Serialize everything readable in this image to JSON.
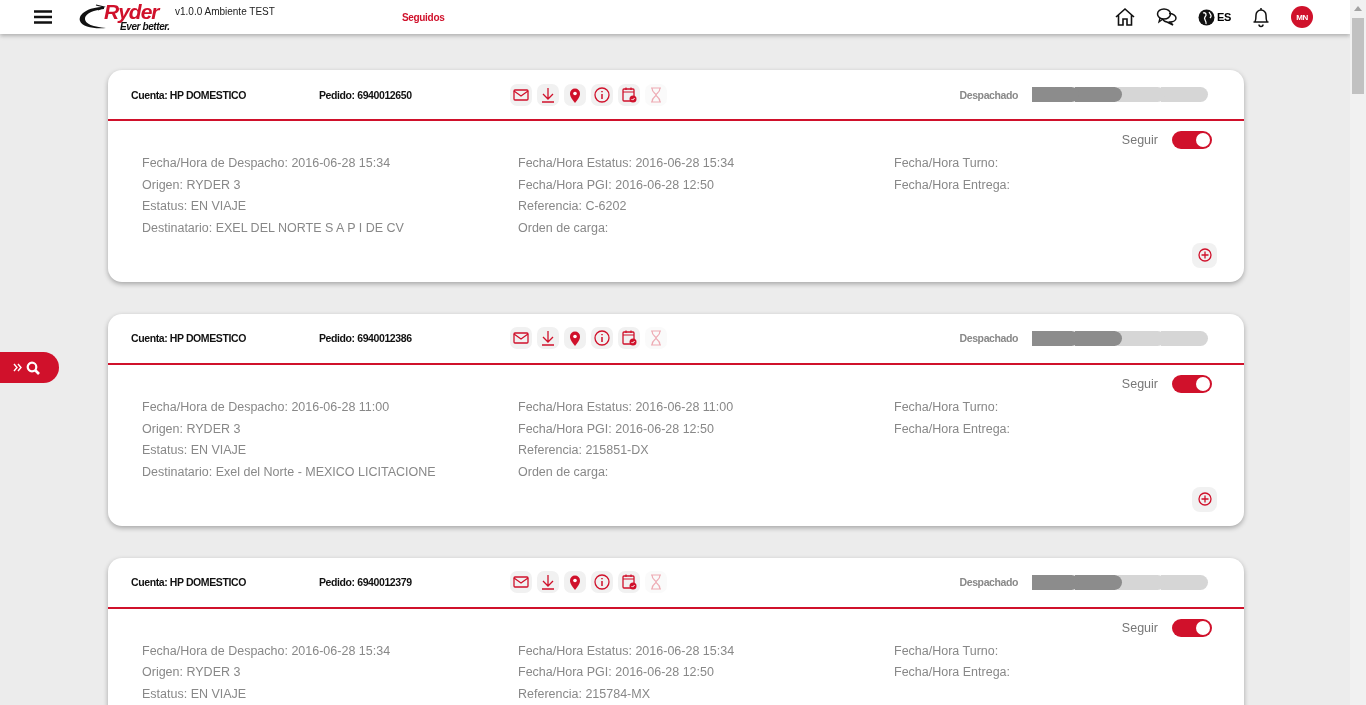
{
  "header": {
    "logo": {
      "name": "Ryder",
      "tagline": "Ever better."
    },
    "version": "v1.0.0 Ambiente TEST",
    "nav_link": "Seguidos",
    "language": "ES",
    "avatar_initials": "MN"
  },
  "orders": [
    {
      "account": "Cuenta: HP DOMESTICO",
      "order": "Pedido: 6940012650",
      "actions": [
        {
          "kind": "email",
          "disabled": false
        },
        {
          "kind": "download",
          "disabled": false
        },
        {
          "kind": "location",
          "disabled": false
        },
        {
          "kind": "info",
          "disabled": false
        },
        {
          "kind": "calendar",
          "disabled": false
        },
        {
          "kind": "hourglass",
          "disabled": true
        }
      ],
      "status": "Despachado",
      "steps": [
        {
          "done": true
        },
        {
          "done": true
        },
        {
          "done": false
        },
        {
          "done": false
        }
      ],
      "follow_label": "Seguir",
      "follow_on": true,
      "columns": [
        [
          "Fecha/Hora de Despacho: 2016-06-28 15:34",
          "Origen: RYDER 3",
          "Estatus: EN VIAJE",
          "Destinatario: EXEL DEL NORTE S A P I DE CV"
        ],
        [
          "Fecha/Hora Estatus: 2016-06-28 15:34",
          "Fecha/Hora PGI: 2016-06-28 12:50",
          "Referencia: C-6202",
          "Orden de carga:"
        ],
        [
          "Fecha/Hora Turno:",
          "Fecha/Hora Entrega:"
        ]
      ]
    },
    {
      "account": "Cuenta: HP DOMESTICO",
      "order": "Pedido: 6940012386",
      "actions": [
        {
          "kind": "email",
          "disabled": false
        },
        {
          "kind": "download",
          "disabled": false
        },
        {
          "kind": "location",
          "disabled": false
        },
        {
          "kind": "info",
          "disabled": false
        },
        {
          "kind": "calendar",
          "disabled": false
        },
        {
          "kind": "hourglass",
          "disabled": true
        }
      ],
      "status": "Despachado",
      "steps": [
        {
          "done": true
        },
        {
          "done": true
        },
        {
          "done": false
        },
        {
          "done": false
        }
      ],
      "follow_label": "Seguir",
      "follow_on": true,
      "columns": [
        [
          "Fecha/Hora de Despacho: 2016-06-28 11:00",
          "Origen: RYDER 3",
          "Estatus: EN VIAJE",
          "Destinatario: Exel del Norte - MEXICO LICITACIONE"
        ],
        [
          "Fecha/Hora Estatus: 2016-06-28 11:00",
          "Fecha/Hora PGI: 2016-06-28 12:50",
          "Referencia: 215851-DX",
          "Orden de carga:"
        ],
        [
          "Fecha/Hora Turno:",
          "Fecha/Hora Entrega:"
        ]
      ]
    },
    {
      "account": "Cuenta: HP DOMESTICO",
      "order": "Pedido: 6940012379",
      "actions": [
        {
          "kind": "email",
          "disabled": false
        },
        {
          "kind": "download",
          "disabled": false
        },
        {
          "kind": "location",
          "disabled": false
        },
        {
          "kind": "info",
          "disabled": false
        },
        {
          "kind": "calendar",
          "disabled": false
        },
        {
          "kind": "hourglass",
          "disabled": true
        }
      ],
      "status": "Despachado",
      "steps": [
        {
          "done": true
        },
        {
          "done": true
        },
        {
          "done": false
        },
        {
          "done": false
        }
      ],
      "follow_label": "Seguir",
      "follow_on": true,
      "columns": [
        [
          "Fecha/Hora de Despacho: 2016-06-28 15:34",
          "Origen: RYDER 3",
          "Estatus: EN VIAJE"
        ],
        [
          "Fecha/Hora Estatus: 2016-06-28 15:34",
          "Fecha/Hora PGI: 2016-06-28 12:50",
          "Referencia: 215784-MX"
        ],
        [
          "Fecha/Hora Turno:",
          "Fecha/Hora Entrega:"
        ]
      ]
    }
  ]
}
